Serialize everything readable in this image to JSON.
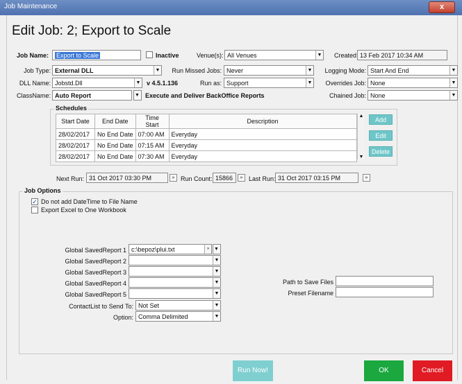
{
  "window": {
    "title": "Job Maintenance",
    "close_label": "x"
  },
  "page_title": "Edit Job: 2; Export to Scale",
  "job": {
    "name_label": "Job Name:",
    "name_value": "Export to Scale",
    "inactive_label": "Inactive",
    "venues_label": "Venue(s):",
    "venues_value": "All Venues",
    "created_label": "Created:",
    "created_value": "13 Feb 2017 10:34 AM",
    "type_label": "Job Type:",
    "type_value": "External DLL",
    "missed_label": "Run Missed Jobs:",
    "missed_value": "Never",
    "logging_label": "Logging Mode:",
    "logging_value": "Start And End",
    "dll_label": "DLL Name:",
    "dll_value": "Jobstd.Dll",
    "dll_version": "v 4.5.1.136",
    "runas_label": "Run as:",
    "runas_value": "Support",
    "overrides_label": "Overrides Job:",
    "overrides_value": "None",
    "class_label": "ClassName:",
    "class_value": "Auto Report",
    "class_desc": "Execute and Deliver BackOffice Reports",
    "chained_label": "Chained Job:",
    "chained_value": "None"
  },
  "schedules": {
    "title": "Schedules",
    "columns": [
      "Start Date",
      "End Date",
      "Time Start",
      "Description"
    ],
    "rows": [
      [
        "28/02/2017",
        "No End Date",
        "07:00 AM",
        "Everyday"
      ],
      [
        "28/02/2017",
        "No End Date",
        "07:15 AM",
        "Everyday"
      ],
      [
        "28/02/2017",
        "No End Date",
        "07:30 AM",
        "Everyday"
      ]
    ],
    "add_label": "Add",
    "edit_label": "Edit",
    "delete_label": "Delete"
  },
  "run": {
    "next_label": "Next Run:",
    "next_value": "31 Oct 2017 03:30 PM",
    "count_label": "Run Count:",
    "count_value": "15866",
    "last_label": "Last Run:",
    "last_value": "31 Oct 2017 03:15 PM"
  },
  "options": {
    "title": "Job Options",
    "no_datetime_label": "Do not add DateTime to File Name",
    "no_datetime_checked": true,
    "export_one_label": "Export Excel to One Workbook",
    "export_one_checked": false,
    "report1_label": "Global SavedReport 1",
    "report1_value": "c:\\bepoz\\plui.txt",
    "report2_label": "Global SavedReport 2",
    "report3_label": "Global SavedReport 3",
    "report4_label": "Global SavedReport 4",
    "report5_label": "Global SavedReport 5",
    "contact_label": "ContactList to Send To:",
    "contact_value": "Not Set",
    "option_label": "Option:",
    "option_value": "Comma Delimited",
    "path_label": "Path to Save Files",
    "path_value": "",
    "preset_label": "Preset Filename",
    "preset_value": ""
  },
  "footer": {
    "run_now_label": "Run Now!",
    "ok_label": "OK",
    "cancel_label": "Cancel"
  },
  "colors": {
    "teal": "#6fc6c9",
    "ok_green": "#1aa83f",
    "cancel_red": "#e01b24",
    "selection": "#3a78d6"
  }
}
